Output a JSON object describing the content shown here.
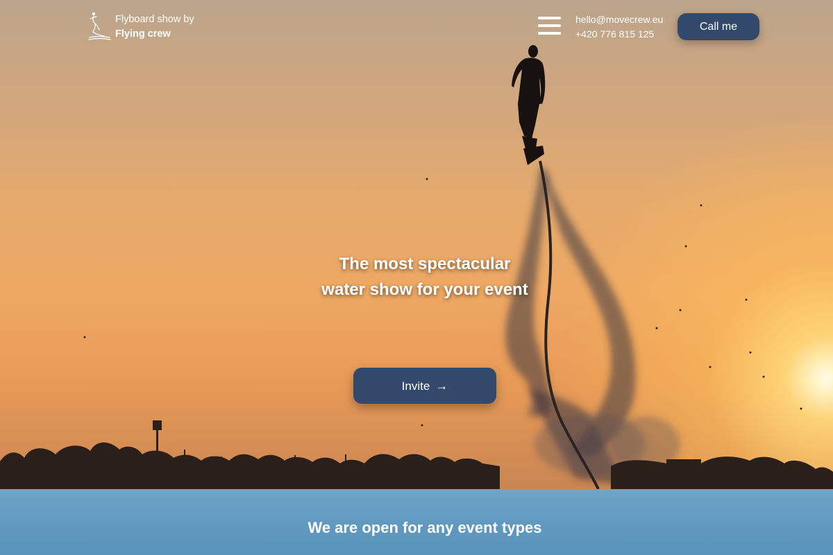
{
  "header": {
    "logo_line1": "Flyboard show by",
    "logo_line2": "Flying crew",
    "logo_icon": "flyboard-rider-icon",
    "menu_icon": "hamburger-menu-icon",
    "email": "hello@movecrew.eu",
    "phone": "+420 776 815 125",
    "call_label": "Call me"
  },
  "hero": {
    "headline_line1": "The most spectacular",
    "headline_line2": "water show for your event",
    "invite_label": "Invite",
    "invite_icon": "arrow-right-icon"
  },
  "band": {
    "title": "We are open for any event types"
  },
  "colors": {
    "button": "#33496b",
    "band": "#5f98bf",
    "sky": "#e8a664"
  }
}
